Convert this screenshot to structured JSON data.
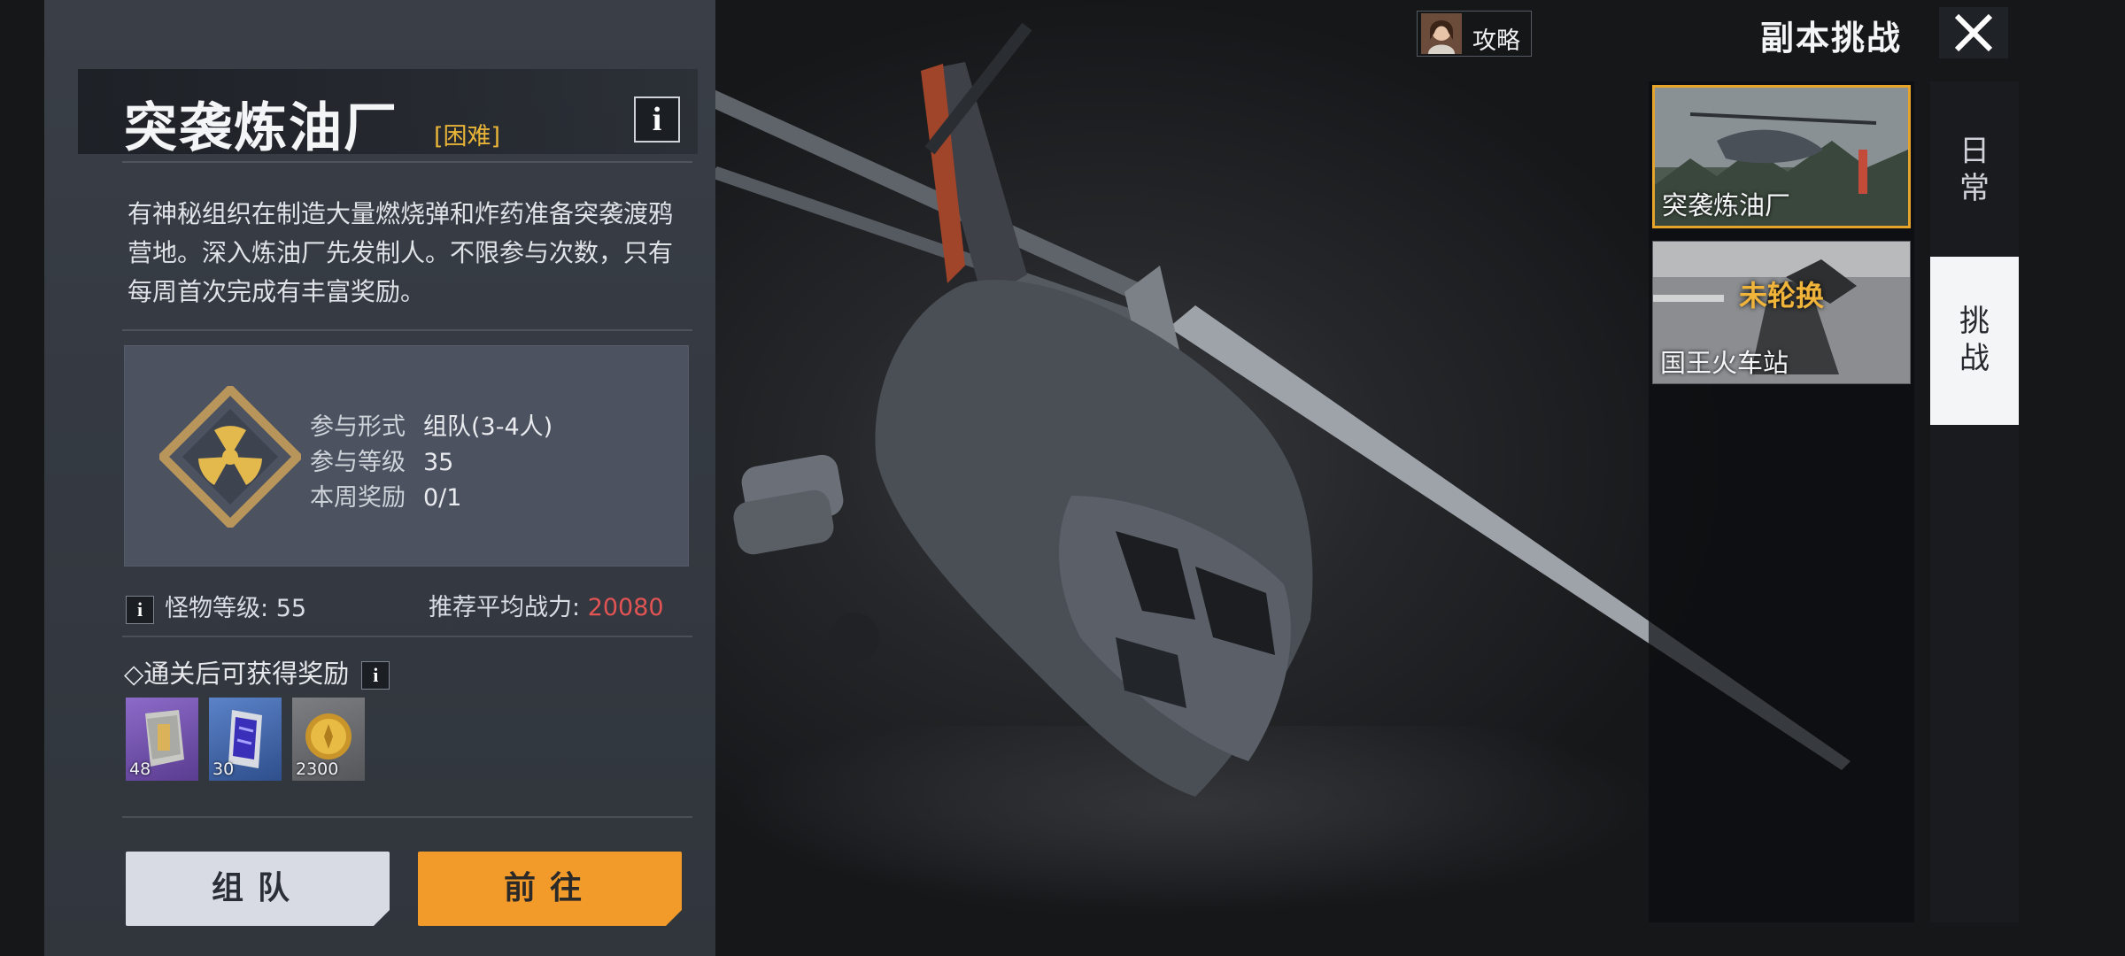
{
  "header": {
    "guide_label": "攻略",
    "page_title": "副本挑战",
    "close_icon": "close-x-icon"
  },
  "dungeon": {
    "title": "突袭炼油厂",
    "difficulty": "[困难]",
    "info_label": "i",
    "description": "有神秘组织在制造大量燃烧弹和炸药准备突袭渡鸦营地。深入炼油厂先发制人。不限参与次数，只有每周首次完成有丰富奖励。",
    "emblem_icon": "radiation-hazard-icon",
    "details": [
      {
        "key": "参与形式",
        "value": "组队(3-4人)"
      },
      {
        "key": "参与等级",
        "value": "35"
      },
      {
        "key": "本周奖励",
        "value": "0/1"
      }
    ],
    "monster_level_label": "怪物等级:",
    "monster_level_value": "55",
    "power_label": "推荐平均战力:",
    "power_value": "20080",
    "reward_title": "◇通关后可获得奖励",
    "rewards": [
      {
        "icon": "armor-plate-icon",
        "count": "48",
        "color": "#6e4aa8"
      },
      {
        "icon": "circuit-card-icon",
        "count": "30",
        "color": "#3c5f9e"
      },
      {
        "icon": "gold-coin-icon",
        "count": "2300",
        "color": "#6a6c70"
      }
    ]
  },
  "buttons": {
    "team": "组队",
    "go": "前往"
  },
  "dungeon_list": [
    {
      "label": "突袭炼油厂",
      "badge": "",
      "selected": true
    },
    {
      "label": "国王火车站",
      "badge": "未轮换",
      "selected": false
    }
  ],
  "tabs": [
    {
      "label": "日常",
      "selected": false
    },
    {
      "label": "挑战",
      "selected": true
    }
  ],
  "colors": {
    "accent_orange": "#f29a2a",
    "difficulty_gold": "#e8b438",
    "power_red": "#e25454",
    "selected_border": "#e6a42a"
  }
}
